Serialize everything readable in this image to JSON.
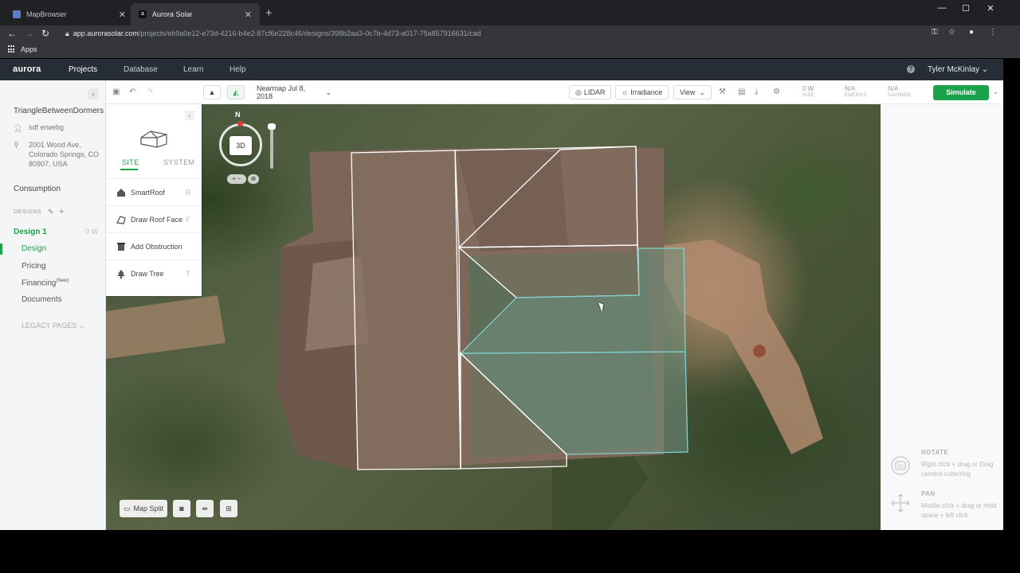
{
  "browser": {
    "tabs": [
      {
        "label": "MapBrowser",
        "active": false,
        "favicon_color": "#5a7fbf"
      },
      {
        "label": "Aurora Solar",
        "active": true,
        "favicon_color": "#111111"
      }
    ],
    "url_host": "app.aurorasolar.com",
    "url_path": "/projects/eb9a0e12-e73d-4216-b4e2-87cf6e228c46/designs/398b2aa3-0c7b-4d73-a017-75a857916631/cad",
    "bookmarks_label": "Apps"
  },
  "appnav": {
    "logo": "aurora",
    "links": [
      "Projects",
      "Database",
      "Learn",
      "Help"
    ],
    "active_link": "Projects",
    "user": "Tyler McKinlay"
  },
  "sidebar": {
    "project_name": "TriangleBetweenDormers",
    "customer": "sdf erwebg",
    "address": "2001 Wood Ave, Colorado Springs, CO 80907, USA",
    "consumption": "Consumption",
    "designs_header": "DESIGNS",
    "design_name": "Design 1",
    "design_size": "0 W",
    "subitems": [
      "Design",
      "Pricing",
      "Financing",
      "Documents"
    ],
    "financing_badge": "(New)",
    "legacy": "LEGACY PAGES"
  },
  "toolbar": {
    "imagery": "Nearmap Jul 8, 2018",
    "lidar": "LIDAR",
    "irradiance": "Irradiance",
    "view": "View",
    "size_value": "0 W",
    "size_label": "SIZE",
    "energy_value": "N/A",
    "energy_label": "ENERGY",
    "savings_value": "N/A",
    "savings_label": "SAVINGS",
    "simulate": "Simulate"
  },
  "sitepanel": {
    "tabs": [
      "SITE",
      "SYSTEM"
    ],
    "active_tab": "SITE",
    "items": [
      {
        "label": "SmartRoof",
        "key": "R",
        "icon": "smartroof-icon"
      },
      {
        "label": "Draw Roof Face",
        "key": "F",
        "icon": "roof-face-icon"
      },
      {
        "label": "Add Obstruction",
        "key": "",
        "icon": "obstruction-icon"
      },
      {
        "label": "Draw Tree",
        "key": "T",
        "icon": "tree-icon"
      }
    ]
  },
  "map": {
    "compass_label": "N",
    "cube_label": "3D",
    "map_split": "Map Split"
  },
  "rightpanel": {
    "rotate_title": "ROTATE",
    "rotate_text": "Right click + drag or Drag camera cube/ring",
    "pan_title": "PAN",
    "pan_text": "Middle click + drag or Hold space + left click"
  },
  "colors": {
    "accent": "#1aa34a",
    "nav_bg": "#272d36",
    "roof_face": "#8a7466",
    "selected_face": "#6f8f7f"
  }
}
